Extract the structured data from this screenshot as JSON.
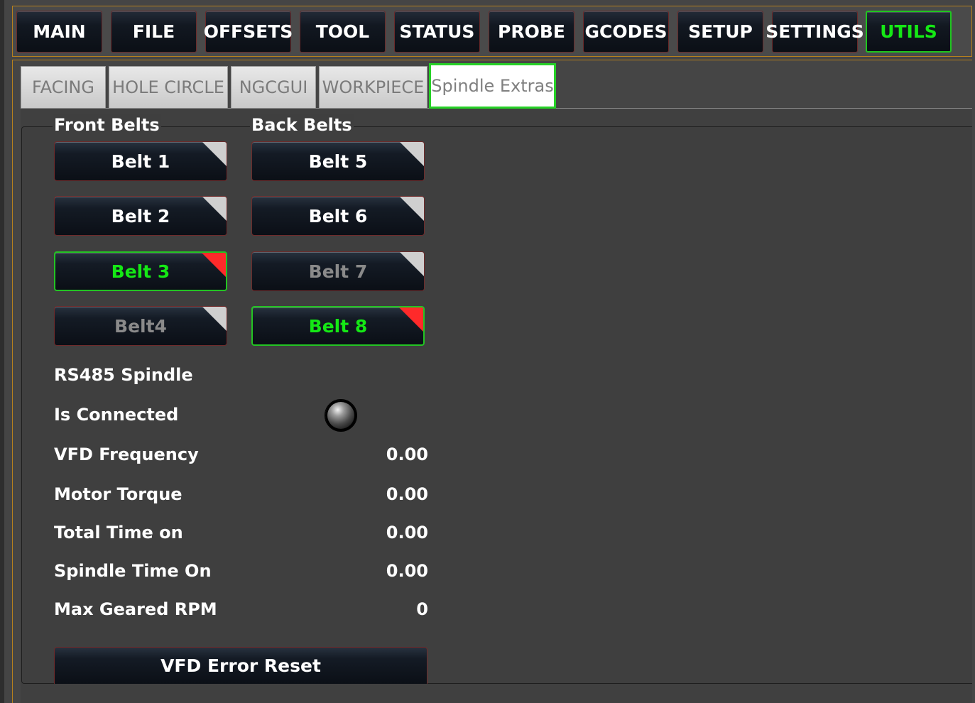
{
  "nav": {
    "items": [
      {
        "label": "MAIN"
      },
      {
        "label": "FILE"
      },
      {
        "label": "OFFSETS"
      },
      {
        "label": "TOOL"
      },
      {
        "label": "STATUS"
      },
      {
        "label": "PROBE"
      },
      {
        "label": "GCODES"
      },
      {
        "label": "SETUP"
      },
      {
        "label": "SETTINGS"
      },
      {
        "label": "UTILS",
        "active": true
      }
    ]
  },
  "tabs": [
    {
      "label": "FACING"
    },
    {
      "label": "HOLE CIRCLE"
    },
    {
      "label": "NGCGUI"
    },
    {
      "label": "WORKPIECE"
    },
    {
      "label": "Spindle Extras",
      "active": true
    }
  ],
  "belts": {
    "front_title": "Front Belts",
    "back_title": "Back Belts",
    "front": [
      {
        "label": "Belt 1",
        "state": "normal"
      },
      {
        "label": "Belt 2",
        "state": "normal"
      },
      {
        "label": "Belt 3",
        "state": "checked"
      },
      {
        "label": "Belt4",
        "state": "disabled"
      }
    ],
    "back": [
      {
        "label": "Belt 5",
        "state": "normal"
      },
      {
        "label": "Belt 6",
        "state": "normal"
      },
      {
        "label": "Belt 7",
        "state": "disabled"
      },
      {
        "label": "Belt 8",
        "state": "checked"
      }
    ]
  },
  "rs485": {
    "title": "RS485 Spindle",
    "connected_label": "Is Connected",
    "rows": [
      {
        "label": "VFD Frequency",
        "value": "0.00"
      },
      {
        "label": "Motor Torque",
        "value": "0.00"
      },
      {
        "label": "Total Time on",
        "value": "0.00"
      },
      {
        "label": "Spindle Time On",
        "value": "0.00"
      },
      {
        "label": "Max Geared RPM",
        "value": "0"
      }
    ],
    "reset_label": "VFD Error Reset"
  },
  "colors": {
    "accent_active": "#15e815",
    "frame_orange": "#b6801d",
    "checked_corner": "#ff2a2a"
  }
}
